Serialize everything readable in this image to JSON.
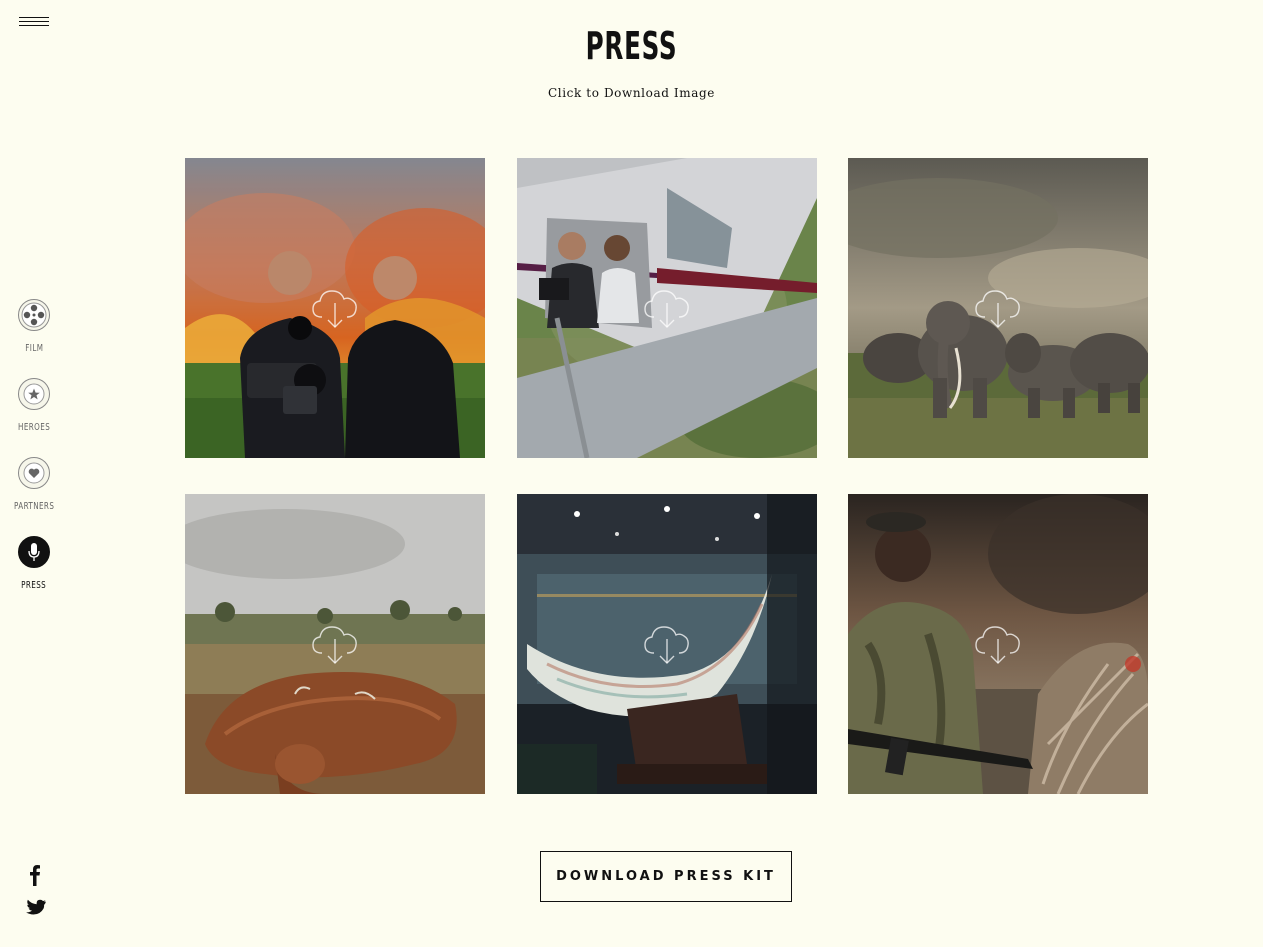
{
  "header": {
    "title": "PRESS",
    "subtitle": "Click to Download Image"
  },
  "menu": {
    "icon": "hamburger-icon"
  },
  "sidenav": {
    "items": [
      {
        "label": "FILM",
        "icon": "film-reel-icon",
        "active": false
      },
      {
        "label": "HEROES",
        "icon": "star-icon",
        "active": false
      },
      {
        "label": "PARTNERS",
        "icon": "heart-icon",
        "active": false
      },
      {
        "label": "PRESS",
        "icon": "microphone-icon",
        "active": true
      }
    ]
  },
  "social": [
    {
      "icon": "facebook-icon"
    },
    {
      "icon": "twitter-icon"
    }
  ],
  "gallery": {
    "download_icon": "cloud-download-icon",
    "images": [
      {
        "subject": "two-men-with-camera-before-fire"
      },
      {
        "subject": "crew-filming-from-plane"
      },
      {
        "subject": "elephant-herd"
      },
      {
        "subject": "dead-elephant"
      },
      {
        "subject": "carved-ivory-tusk"
      },
      {
        "subject": "ranger-with-ivory-pile"
      }
    ]
  },
  "actions": {
    "press_kit_label": "DOWNLOAD PRESS KIT"
  },
  "colors": {
    "background": "#fdfdf0",
    "text": "#111111",
    "muted": "#666666"
  }
}
